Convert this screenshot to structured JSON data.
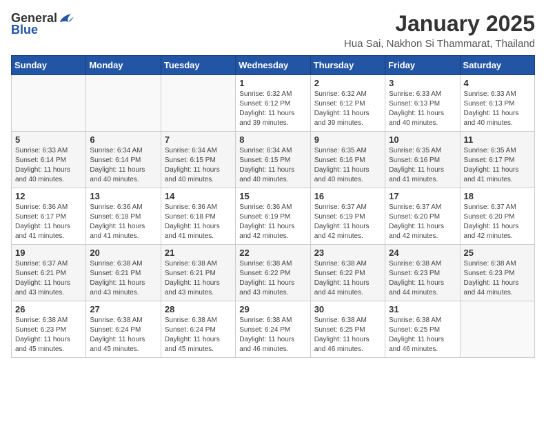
{
  "header": {
    "logo_general": "General",
    "logo_blue": "Blue",
    "month": "January 2025",
    "location": "Hua Sai, Nakhon Si Thammarat, Thailand"
  },
  "weekdays": [
    "Sunday",
    "Monday",
    "Tuesday",
    "Wednesday",
    "Thursday",
    "Friday",
    "Saturday"
  ],
  "weeks": [
    [
      {
        "day": "",
        "info": ""
      },
      {
        "day": "",
        "info": ""
      },
      {
        "day": "",
        "info": ""
      },
      {
        "day": "1",
        "info": "Sunrise: 6:32 AM\nSunset: 6:12 PM\nDaylight: 11 hours\nand 39 minutes."
      },
      {
        "day": "2",
        "info": "Sunrise: 6:32 AM\nSunset: 6:12 PM\nDaylight: 11 hours\nand 39 minutes."
      },
      {
        "day": "3",
        "info": "Sunrise: 6:33 AM\nSunset: 6:13 PM\nDaylight: 11 hours\nand 40 minutes."
      },
      {
        "day": "4",
        "info": "Sunrise: 6:33 AM\nSunset: 6:13 PM\nDaylight: 11 hours\nand 40 minutes."
      }
    ],
    [
      {
        "day": "5",
        "info": "Sunrise: 6:33 AM\nSunset: 6:14 PM\nDaylight: 11 hours\nand 40 minutes."
      },
      {
        "day": "6",
        "info": "Sunrise: 6:34 AM\nSunset: 6:14 PM\nDaylight: 11 hours\nand 40 minutes."
      },
      {
        "day": "7",
        "info": "Sunrise: 6:34 AM\nSunset: 6:15 PM\nDaylight: 11 hours\nand 40 minutes."
      },
      {
        "day": "8",
        "info": "Sunrise: 6:34 AM\nSunset: 6:15 PM\nDaylight: 11 hours\nand 40 minutes."
      },
      {
        "day": "9",
        "info": "Sunrise: 6:35 AM\nSunset: 6:16 PM\nDaylight: 11 hours\nand 40 minutes."
      },
      {
        "day": "10",
        "info": "Sunrise: 6:35 AM\nSunset: 6:16 PM\nDaylight: 11 hours\nand 41 minutes."
      },
      {
        "day": "11",
        "info": "Sunrise: 6:35 AM\nSunset: 6:17 PM\nDaylight: 11 hours\nand 41 minutes."
      }
    ],
    [
      {
        "day": "12",
        "info": "Sunrise: 6:36 AM\nSunset: 6:17 PM\nDaylight: 11 hours\nand 41 minutes."
      },
      {
        "day": "13",
        "info": "Sunrise: 6:36 AM\nSunset: 6:18 PM\nDaylight: 11 hours\nand 41 minutes."
      },
      {
        "day": "14",
        "info": "Sunrise: 6:36 AM\nSunset: 6:18 PM\nDaylight: 11 hours\nand 41 minutes."
      },
      {
        "day": "15",
        "info": "Sunrise: 6:36 AM\nSunset: 6:19 PM\nDaylight: 11 hours\nand 42 minutes."
      },
      {
        "day": "16",
        "info": "Sunrise: 6:37 AM\nSunset: 6:19 PM\nDaylight: 11 hours\nand 42 minutes."
      },
      {
        "day": "17",
        "info": "Sunrise: 6:37 AM\nSunset: 6:20 PM\nDaylight: 11 hours\nand 42 minutes."
      },
      {
        "day": "18",
        "info": "Sunrise: 6:37 AM\nSunset: 6:20 PM\nDaylight: 11 hours\nand 42 minutes."
      }
    ],
    [
      {
        "day": "19",
        "info": "Sunrise: 6:37 AM\nSunset: 6:21 PM\nDaylight: 11 hours\nand 43 minutes."
      },
      {
        "day": "20",
        "info": "Sunrise: 6:38 AM\nSunset: 6:21 PM\nDaylight: 11 hours\nand 43 minutes."
      },
      {
        "day": "21",
        "info": "Sunrise: 6:38 AM\nSunset: 6:21 PM\nDaylight: 11 hours\nand 43 minutes."
      },
      {
        "day": "22",
        "info": "Sunrise: 6:38 AM\nSunset: 6:22 PM\nDaylight: 11 hours\nand 43 minutes."
      },
      {
        "day": "23",
        "info": "Sunrise: 6:38 AM\nSunset: 6:22 PM\nDaylight: 11 hours\nand 44 minutes."
      },
      {
        "day": "24",
        "info": "Sunrise: 6:38 AM\nSunset: 6:23 PM\nDaylight: 11 hours\nand 44 minutes."
      },
      {
        "day": "25",
        "info": "Sunrise: 6:38 AM\nSunset: 6:23 PM\nDaylight: 11 hours\nand 44 minutes."
      }
    ],
    [
      {
        "day": "26",
        "info": "Sunrise: 6:38 AM\nSunset: 6:23 PM\nDaylight: 11 hours\nand 45 minutes."
      },
      {
        "day": "27",
        "info": "Sunrise: 6:38 AM\nSunset: 6:24 PM\nDaylight: 11 hours\nand 45 minutes."
      },
      {
        "day": "28",
        "info": "Sunrise: 6:38 AM\nSunset: 6:24 PM\nDaylight: 11 hours\nand 45 minutes."
      },
      {
        "day": "29",
        "info": "Sunrise: 6:38 AM\nSunset: 6:24 PM\nDaylight: 11 hours\nand 46 minutes."
      },
      {
        "day": "30",
        "info": "Sunrise: 6:38 AM\nSunset: 6:25 PM\nDaylight: 11 hours\nand 46 minutes."
      },
      {
        "day": "31",
        "info": "Sunrise: 6:38 AM\nSunset: 6:25 PM\nDaylight: 11 hours\nand 46 minutes."
      },
      {
        "day": "",
        "info": ""
      }
    ]
  ]
}
